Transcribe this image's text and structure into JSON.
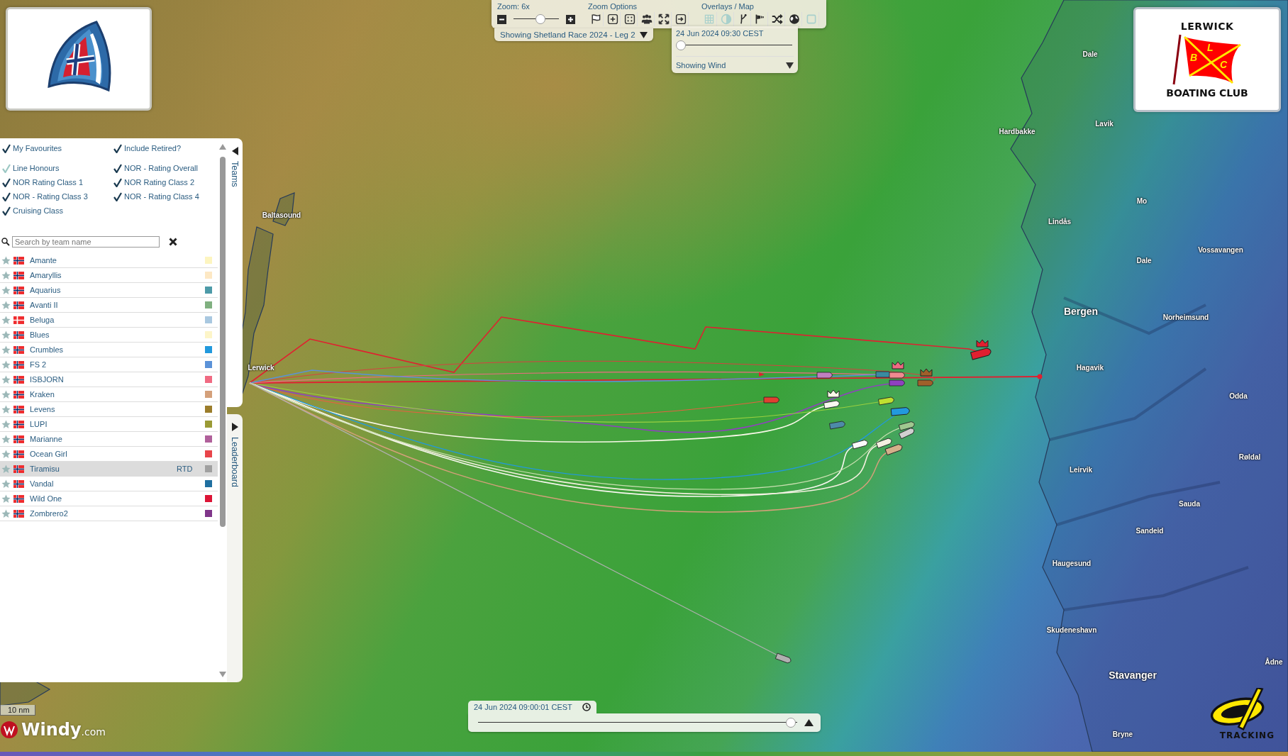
{
  "toolbar": {
    "zoom": {
      "label": "Zoom: 6x",
      "level": 0.6
    },
    "zoom_options": {
      "title": "Zoom Options",
      "buttons": [
        {
          "kind": "flag"
        },
        {
          "kind": "plus"
        },
        {
          "kind": "dice"
        },
        {
          "kind": "people"
        },
        {
          "kind": "expand"
        },
        {
          "kind": "enter"
        }
      ]
    },
    "overlays": {
      "title": "Overlays / Map",
      "buttons": [
        {
          "kind": "grid",
          "on": false
        },
        {
          "kind": "contrast",
          "on": false
        },
        {
          "kind": "branch",
          "on": true
        },
        {
          "kind": "windsock",
          "on": true
        },
        {
          "kind": "shuffle",
          "on": true
        },
        {
          "kind": "globe",
          "on": true
        },
        {
          "kind": "square",
          "on": false
        }
      ]
    },
    "race_selector": "Showing Shetland Race 2024 - Leg 2"
  },
  "time_panel": {
    "time": "24 Jun 2024 09:30 CEST",
    "level": 0,
    "layer": "Showing Wind"
  },
  "club_logo": {
    "top": "LERWICK",
    "bottom": "BOATING CLUB",
    "flag_letters": [
      "B",
      "L",
      "C"
    ]
  },
  "team_panel": {
    "tabs": [
      {
        "label": "Teams",
        "selected": true
      },
      {
        "label": "Leaderboard",
        "selected": false
      }
    ],
    "filters": [
      {
        "label": "My Favourites",
        "checked": true,
        "disabled": false
      },
      {
        "label": "Include Retired?",
        "checked": true,
        "disabled": false
      },
      {
        "label": "Line Honours",
        "checked": true,
        "disabled": true
      },
      {
        "label": "NOR - Rating Overall",
        "checked": true,
        "disabled": false
      },
      {
        "label": "NOR Rating Class 1",
        "checked": true,
        "disabled": false
      },
      {
        "label": "NOR Rating Class 2",
        "checked": true,
        "disabled": false
      },
      {
        "label": "NOR - Rating Class 3",
        "checked": true,
        "disabled": false
      },
      {
        "label": "NOR - Rating Class 4",
        "checked": true,
        "disabled": false
      },
      {
        "label": "Cruising Class",
        "checked": true,
        "disabled": false
      }
    ],
    "search": {
      "placeholder": "Search by team name"
    },
    "teams": [
      {
        "name": "Amante",
        "kind": "norway",
        "favourite": false,
        "selected": false,
        "color": "#fdf5c0"
      },
      {
        "name": "Amaryllis",
        "kind": "norway",
        "favourite": false,
        "selected": false,
        "color": "#fde8c4"
      },
      {
        "name": "Aquarius",
        "kind": "norway",
        "favourite": false,
        "selected": false,
        "color": "#4d9aa8"
      },
      {
        "name": "Avanti II",
        "kind": "norway",
        "favourite": false,
        "selected": false,
        "color": "#80b080"
      },
      {
        "name": "Beluga",
        "kind": "denmark",
        "favourite": false,
        "selected": false,
        "color": "#a9c8e0"
      },
      {
        "name": "Blues",
        "kind": "norway",
        "favourite": false,
        "selected": false,
        "color": "#fdf5c8"
      },
      {
        "name": "Crumbles",
        "kind": "norway",
        "favourite": false,
        "selected": false,
        "color": "#2299dd"
      },
      {
        "name": "FS 2",
        "kind": "norway",
        "favourite": false,
        "selected": false,
        "color": "#5b92d8"
      },
      {
        "name": "ISBJORN",
        "kind": "norway",
        "favourite": false,
        "selected": false,
        "color": "#f06a82"
      },
      {
        "name": "Kraken",
        "kind": "norway",
        "favourite": false,
        "selected": false,
        "color": "#d4a07a"
      },
      {
        "name": "Levens",
        "kind": "norway",
        "favourite": false,
        "selected": false,
        "color": "#9b7d2b"
      },
      {
        "name": "LUPI",
        "kind": "norway",
        "favourite": false,
        "selected": false,
        "color": "#9a9a35"
      },
      {
        "name": "Marianne",
        "kind": "norway",
        "favourite": false,
        "selected": false,
        "color": "#b0609a"
      },
      {
        "name": "Ocean Girl",
        "kind": "norway",
        "favourite": false,
        "selected": false,
        "color": "#e8454a"
      },
      {
        "name": "Tiramisu",
        "kind": "norway",
        "favourite": false,
        "selected": true,
        "status": "RTD",
        "color": "#a0a0a0"
      },
      {
        "name": "Vandal",
        "kind": "norway",
        "favourite": false,
        "selected": false,
        "color": "#1f6fa0"
      },
      {
        "name": "Wild One",
        "kind": "norway",
        "favourite": false,
        "selected": false,
        "color": "#dc1436"
      },
      {
        "name": "Zombrero2",
        "kind": "norway",
        "favourite": false,
        "selected": false,
        "color": "#80368a"
      }
    ]
  },
  "map": {
    "labels": [
      {
        "text": "Baltasound",
        "kind": "town"
      },
      {
        "text": "Lerwick",
        "kind": "town"
      },
      {
        "text": "Dale",
        "kind": "town"
      },
      {
        "text": "Lavik",
        "kind": "town"
      },
      {
        "text": "Hardbakke",
        "kind": "town"
      },
      {
        "text": "Mo",
        "kind": "town"
      },
      {
        "text": "Lindås",
        "kind": "town"
      },
      {
        "text": "Vossavangen",
        "kind": "town"
      },
      {
        "text": "Dale",
        "kind": "town"
      },
      {
        "text": "Bergen",
        "kind": "city"
      },
      {
        "text": "Norheimsund",
        "kind": "town"
      },
      {
        "text": "Hagavik",
        "kind": "town"
      },
      {
        "text": "Odda",
        "kind": "town"
      },
      {
        "text": "Røldal",
        "kind": "town"
      },
      {
        "text": "Leirvik",
        "kind": "town"
      },
      {
        "text": "Sauda",
        "kind": "town"
      },
      {
        "text": "Sandeid",
        "kind": "town"
      },
      {
        "text": "Haugesund",
        "kind": "town"
      },
      {
        "text": "Skudeneshavn",
        "kind": "town"
      },
      {
        "text": "Stavanger",
        "kind": "city"
      },
      {
        "text": "Bryne",
        "kind": "town"
      },
      {
        "text": "Ådne",
        "kind": "town"
      }
    ],
    "scale": "10 nm"
  },
  "windy_logo": {
    "name": "Windy",
    "suffix": ".com"
  },
  "playback": {
    "time": "24 Jun 2024 09:00:01 CEST",
    "level": 0.98
  },
  "tracking_logo": "TRACKING"
}
